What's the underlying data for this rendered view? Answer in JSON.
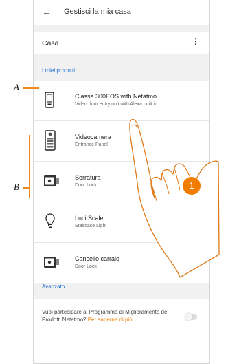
{
  "header": {
    "title": "Gestisci la mia casa",
    "back_icon": "back-arrow-icon"
  },
  "house": {
    "label": "Casa",
    "menu_icon": "kebab-menu-icon"
  },
  "products_section": {
    "header": "I miei prodotti",
    "items": [
      {
        "title": "Classe 300EOS with Netatmo",
        "subtitle": "Video door entry unit with Alexa built in",
        "icon": "video-door-entry-icon"
      },
      {
        "title": "Videocamera",
        "subtitle": "Entrance Panel",
        "icon": "entrance-panel-icon"
      },
      {
        "title": "Serratura",
        "subtitle": "Door Lock",
        "icon": "door-lock-icon"
      },
      {
        "title": "Luci Scale",
        "subtitle": "Staircase Light",
        "icon": "light-bulb-icon"
      },
      {
        "title": "Cancello carraio",
        "subtitle": "Door Lock",
        "icon": "door-lock-icon"
      }
    ]
  },
  "advanced_section": {
    "header": "Avanzato",
    "text": "Vuoi partecipare al Programma di Miglioramento dei Prodotti Netatmo?",
    "link": "Per saperne di più.",
    "toggle_on": false
  },
  "callouts": {
    "a": "A",
    "b": "B"
  },
  "step_badge": "1",
  "colors": {
    "accent_blue": "#1f6fd1",
    "accent_orange": "#f07c00",
    "background": "#f1f1f1"
  }
}
